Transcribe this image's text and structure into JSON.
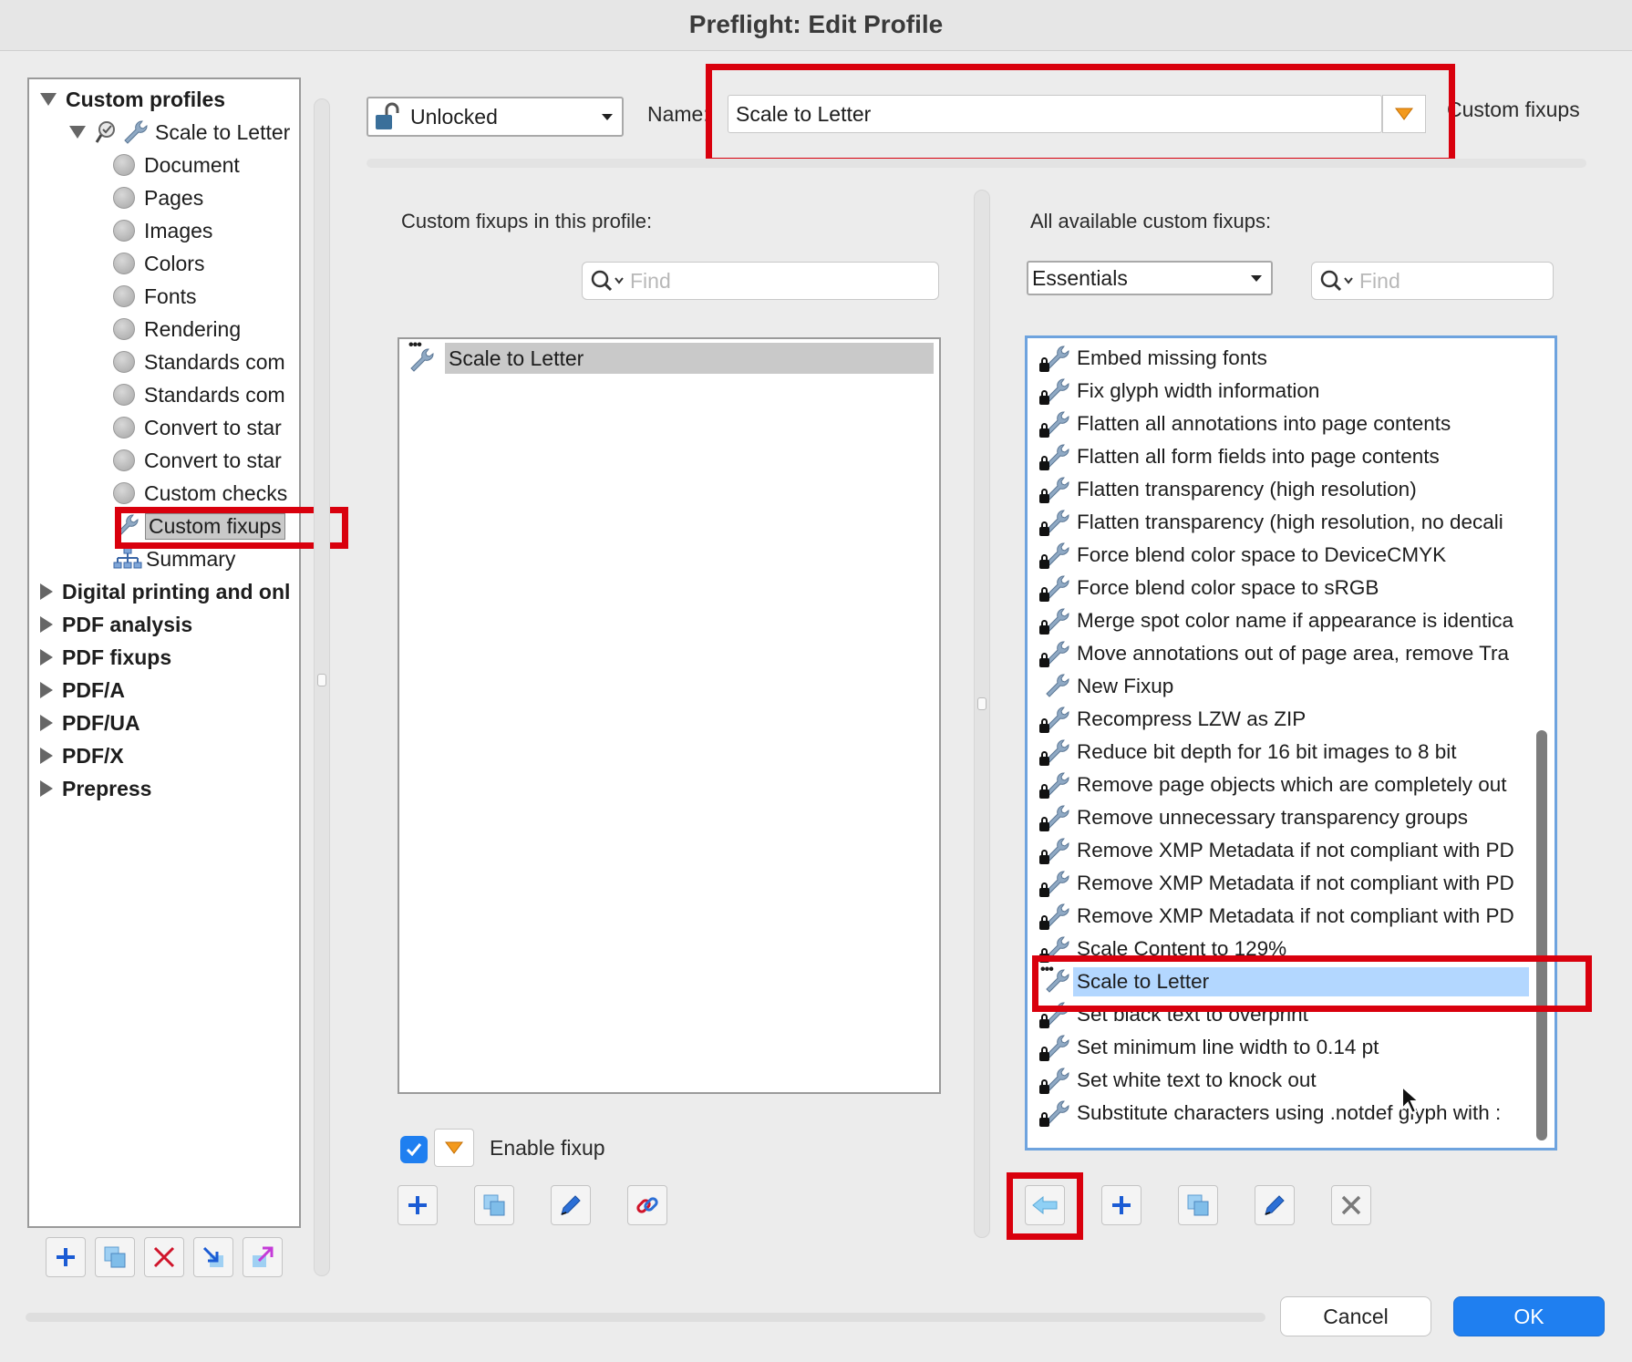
{
  "window": {
    "title": "Preflight: Edit Profile"
  },
  "tree": {
    "root_label": "Custom profiles",
    "profile_label": "Scale to Letter",
    "children": [
      "Document",
      "Pages",
      "Images",
      "Colors",
      "Fonts",
      "Rendering",
      "Standards com",
      "Standards com",
      "Convert to star",
      "Convert to star",
      "Custom checks"
    ],
    "selected_item": "Custom fixups",
    "summary_item": "Summary",
    "groups": [
      "Digital printing and onl",
      "PDF analysis",
      "PDF fixups",
      "PDF/A",
      "PDF/UA",
      "PDF/X",
      "Prepress"
    ]
  },
  "header": {
    "lock_state": "Unlocked",
    "name_label": "Name:",
    "name_value": "Scale to Letter",
    "section_label": "Custom fixups"
  },
  "left_panel": {
    "heading": "Custom fixups in this profile:",
    "find_placeholder": "Find",
    "items": [
      "Scale to Letter"
    ],
    "enable_label": "Enable fixup",
    "enable_checked": true
  },
  "right_panel": {
    "heading": "All available custom fixups:",
    "library_selected": "Essentials",
    "find_placeholder": "Find",
    "items": [
      "Embed missing fonts",
      "Fix glyph width information",
      "Flatten all annotations into page contents",
      "Flatten all form fields into page contents",
      "Flatten transparency (high resolution)",
      "Flatten transparency (high resolution, no decali",
      "Force blend color space to DeviceCMYK",
      "Force blend color space to sRGB",
      "Merge spot color name if appearance is identica",
      "Move annotations out of page area, remove Tra",
      "New Fixup",
      "Recompress LZW as ZIP",
      "Reduce bit depth for 16 bit images to 8 bit",
      "Remove page objects which are completely out",
      "Remove unnecessary transparency groups",
      "Remove XMP Metadata if not compliant with PD",
      "Remove XMP Metadata if not compliant with PD",
      "Remove XMP Metadata if not compliant with PD",
      "Scale Content to 129%",
      "Scale to Letter",
      "Set black text to overprint",
      "Set minimum line width to 0.14 pt",
      "Set white text to knock out",
      "Substitute characters using .notdef glyph with :"
    ],
    "selected_index": 19
  },
  "footer": {
    "cancel_label": "Cancel",
    "ok_label": "OK"
  },
  "colors": {
    "highlight": "#d9000d",
    "selection": "#b3d7ff",
    "accent": "#1f7ff0"
  }
}
